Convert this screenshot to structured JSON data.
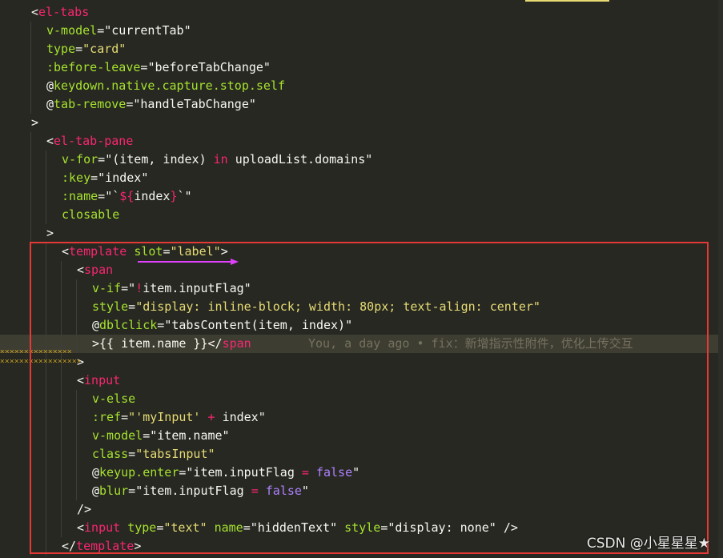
{
  "blame": "You, a day ago • fix：新增指示性附件，优化上传交互",
  "watermark": "CSDN @小星星星★",
  "colors": {
    "background": "#272822",
    "tag": "#f92672",
    "attribute": "#a6e22e",
    "string": "#e6db74",
    "constant": "#ae81ff",
    "text": "#f8f8f2",
    "highlight_box": "#e53935",
    "arrow": "#e040fb"
  },
  "lines": [
    {
      "indent": 1,
      "tokens": [
        {
          "t": "<",
          "c": "punc"
        },
        {
          "t": "el-tabs",
          "c": "tag"
        }
      ]
    },
    {
      "indent": 2,
      "tokens": [
        {
          "t": "v-model",
          "c": "attr"
        },
        {
          "t": "=",
          "c": "punc"
        },
        {
          "t": "\"currentTab\"",
          "c": "var"
        }
      ]
    },
    {
      "indent": 2,
      "tokens": [
        {
          "t": "type",
          "c": "attr"
        },
        {
          "t": "=",
          "c": "punc"
        },
        {
          "t": "\"card\"",
          "c": "str"
        }
      ]
    },
    {
      "indent": 2,
      "tokens": [
        {
          "t": ":before-leave",
          "c": "attr"
        },
        {
          "t": "=",
          "c": "punc"
        },
        {
          "t": "\"beforeTabChange\"",
          "c": "var"
        }
      ]
    },
    {
      "indent": 2,
      "tokens": [
        {
          "t": "@",
          "c": "punc"
        },
        {
          "t": "keydown",
          "c": "attr"
        },
        {
          "t": ".native.capture.stop.self",
          "c": "attr"
        }
      ]
    },
    {
      "indent": 2,
      "tokens": [
        {
          "t": "@",
          "c": "punc"
        },
        {
          "t": "tab-remove",
          "c": "attr"
        },
        {
          "t": "=",
          "c": "punc"
        },
        {
          "t": "\"handleTabChange\"",
          "c": "var"
        }
      ]
    },
    {
      "indent": 1,
      "tokens": [
        {
          "t": ">",
          "c": "punc"
        }
      ]
    },
    {
      "indent": 2,
      "tokens": [
        {
          "t": "<",
          "c": "punc"
        },
        {
          "t": "el-tab-pane",
          "c": "tag"
        }
      ]
    },
    {
      "indent": 3,
      "tokens": [
        {
          "t": "v-for",
          "c": "attr"
        },
        {
          "t": "=",
          "c": "punc"
        },
        {
          "t": "\"(item, index) ",
          "c": "var"
        },
        {
          "t": "in",
          "c": "kw"
        },
        {
          "t": " uploadList.domains\"",
          "c": "var"
        }
      ]
    },
    {
      "indent": 3,
      "tokens": [
        {
          "t": ":key",
          "c": "attr"
        },
        {
          "t": "=",
          "c": "punc"
        },
        {
          "t": "\"index\"",
          "c": "var"
        }
      ]
    },
    {
      "indent": 3,
      "tokens": [
        {
          "t": ":name",
          "c": "attr"
        },
        {
          "t": "=",
          "c": "punc"
        },
        {
          "t": "\"`",
          "c": "var"
        },
        {
          "t": "${",
          "c": "kw"
        },
        {
          "t": "index",
          "c": "var"
        },
        {
          "t": "}",
          "c": "kw"
        },
        {
          "t": "`\"",
          "c": "var"
        }
      ]
    },
    {
      "indent": 3,
      "tokens": [
        {
          "t": "closable",
          "c": "attr"
        }
      ]
    },
    {
      "indent": 2,
      "tokens": [
        {
          "t": ">",
          "c": "punc"
        }
      ]
    },
    {
      "indent": 3,
      "tokens": [
        {
          "t": "<",
          "c": "punc"
        },
        {
          "t": "template",
          "c": "tag"
        },
        {
          "t": " ",
          "c": "punc"
        },
        {
          "t": "slot",
          "c": "attr"
        },
        {
          "t": "=",
          "c": "punc"
        },
        {
          "t": "\"label\"",
          "c": "str"
        },
        {
          "t": ">",
          "c": "punc"
        }
      ]
    },
    {
      "indent": 4,
      "tokens": [
        {
          "t": "<",
          "c": "punc"
        },
        {
          "t": "span",
          "c": "tag"
        }
      ]
    },
    {
      "indent": 5,
      "tokens": [
        {
          "t": "v-if",
          "c": "attr"
        },
        {
          "t": "=",
          "c": "punc"
        },
        {
          "t": "\"",
          "c": "var"
        },
        {
          "t": "!",
          "c": "kw"
        },
        {
          "t": "item.inputFlag\"",
          "c": "var"
        }
      ]
    },
    {
      "indent": 5,
      "tokens": [
        {
          "t": "style",
          "c": "attr"
        },
        {
          "t": "=",
          "c": "punc"
        },
        {
          "t": "\"display: inline-block; width: 80px; text-align: center\"",
          "c": "str"
        }
      ]
    },
    {
      "indent": 5,
      "tokens": [
        {
          "t": "@",
          "c": "punc"
        },
        {
          "t": "dblclick",
          "c": "attr"
        },
        {
          "t": "=",
          "c": "punc"
        },
        {
          "t": "\"tabsContent(item, index)\"",
          "c": "var"
        }
      ]
    },
    {
      "indent": 5,
      "current": true,
      "tokens": [
        {
          "t": ">{{ item.name }}</",
          "c": "punc"
        },
        {
          "t": "span",
          "c": "tag"
        }
      ]
    },
    {
      "indent": 4,
      "tokens": [
        {
          "t": ">",
          "c": "punc"
        }
      ]
    },
    {
      "indent": 4,
      "tokens": [
        {
          "t": "<",
          "c": "punc"
        },
        {
          "t": "input",
          "c": "tag"
        }
      ]
    },
    {
      "indent": 5,
      "tokens": [
        {
          "t": "v-else",
          "c": "attr"
        }
      ]
    },
    {
      "indent": 5,
      "tokens": [
        {
          "t": ":ref",
          "c": "attr"
        },
        {
          "t": "=",
          "c": "punc"
        },
        {
          "t": "\"'myInput'",
          "c": "str"
        },
        {
          "t": " + ",
          "c": "kw"
        },
        {
          "t": "index\"",
          "c": "var"
        }
      ]
    },
    {
      "indent": 5,
      "tokens": [
        {
          "t": "v-model",
          "c": "attr"
        },
        {
          "t": "=",
          "c": "punc"
        },
        {
          "t": "\"item.name\"",
          "c": "var"
        }
      ]
    },
    {
      "indent": 5,
      "tokens": [
        {
          "t": "class",
          "c": "attr"
        },
        {
          "t": "=",
          "c": "punc"
        },
        {
          "t": "\"tabsInput\"",
          "c": "str"
        }
      ]
    },
    {
      "indent": 5,
      "tokens": [
        {
          "t": "@",
          "c": "punc"
        },
        {
          "t": "keyup.enter",
          "c": "attr"
        },
        {
          "t": "=",
          "c": "punc"
        },
        {
          "t": "\"item.inputFlag ",
          "c": "var"
        },
        {
          "t": "=",
          "c": "kw"
        },
        {
          "t": " ",
          "c": "var"
        },
        {
          "t": "false",
          "c": "const"
        },
        {
          "t": "\"",
          "c": "var"
        }
      ]
    },
    {
      "indent": 5,
      "tokens": [
        {
          "t": "@",
          "c": "punc"
        },
        {
          "t": "blur",
          "c": "attr"
        },
        {
          "t": "=",
          "c": "punc"
        },
        {
          "t": "\"item.inputFlag ",
          "c": "var"
        },
        {
          "t": "=",
          "c": "kw"
        },
        {
          "t": " ",
          "c": "var"
        },
        {
          "t": "false",
          "c": "const"
        },
        {
          "t": "\"",
          "c": "var"
        }
      ]
    },
    {
      "indent": 4,
      "tokens": [
        {
          "t": "/>",
          "c": "punc"
        }
      ]
    },
    {
      "indent": 4,
      "tokens": [
        {
          "t": "<",
          "c": "punc"
        },
        {
          "t": "input",
          "c": "tag"
        },
        {
          "t": " ",
          "c": "punc"
        },
        {
          "t": "type",
          "c": "attr"
        },
        {
          "t": "=",
          "c": "punc"
        },
        {
          "t": "\"text\"",
          "c": "str"
        },
        {
          "t": " ",
          "c": "punc"
        },
        {
          "t": "name",
          "c": "attr"
        },
        {
          "t": "=",
          "c": "punc"
        },
        {
          "t": "\"hiddenText\"",
          "c": "var"
        },
        {
          "t": " ",
          "c": "punc"
        },
        {
          "t": "style",
          "c": "attr"
        },
        {
          "t": "=",
          "c": "punc"
        },
        {
          "t": "\"display: none\"",
          "c": "var"
        },
        {
          "t": " />",
          "c": "punc"
        }
      ]
    },
    {
      "indent": 3,
      "tokens": [
        {
          "t": "</",
          "c": "punc"
        },
        {
          "t": "template",
          "c": "tag"
        },
        {
          "t": ">",
          "c": "punc"
        }
      ]
    }
  ]
}
